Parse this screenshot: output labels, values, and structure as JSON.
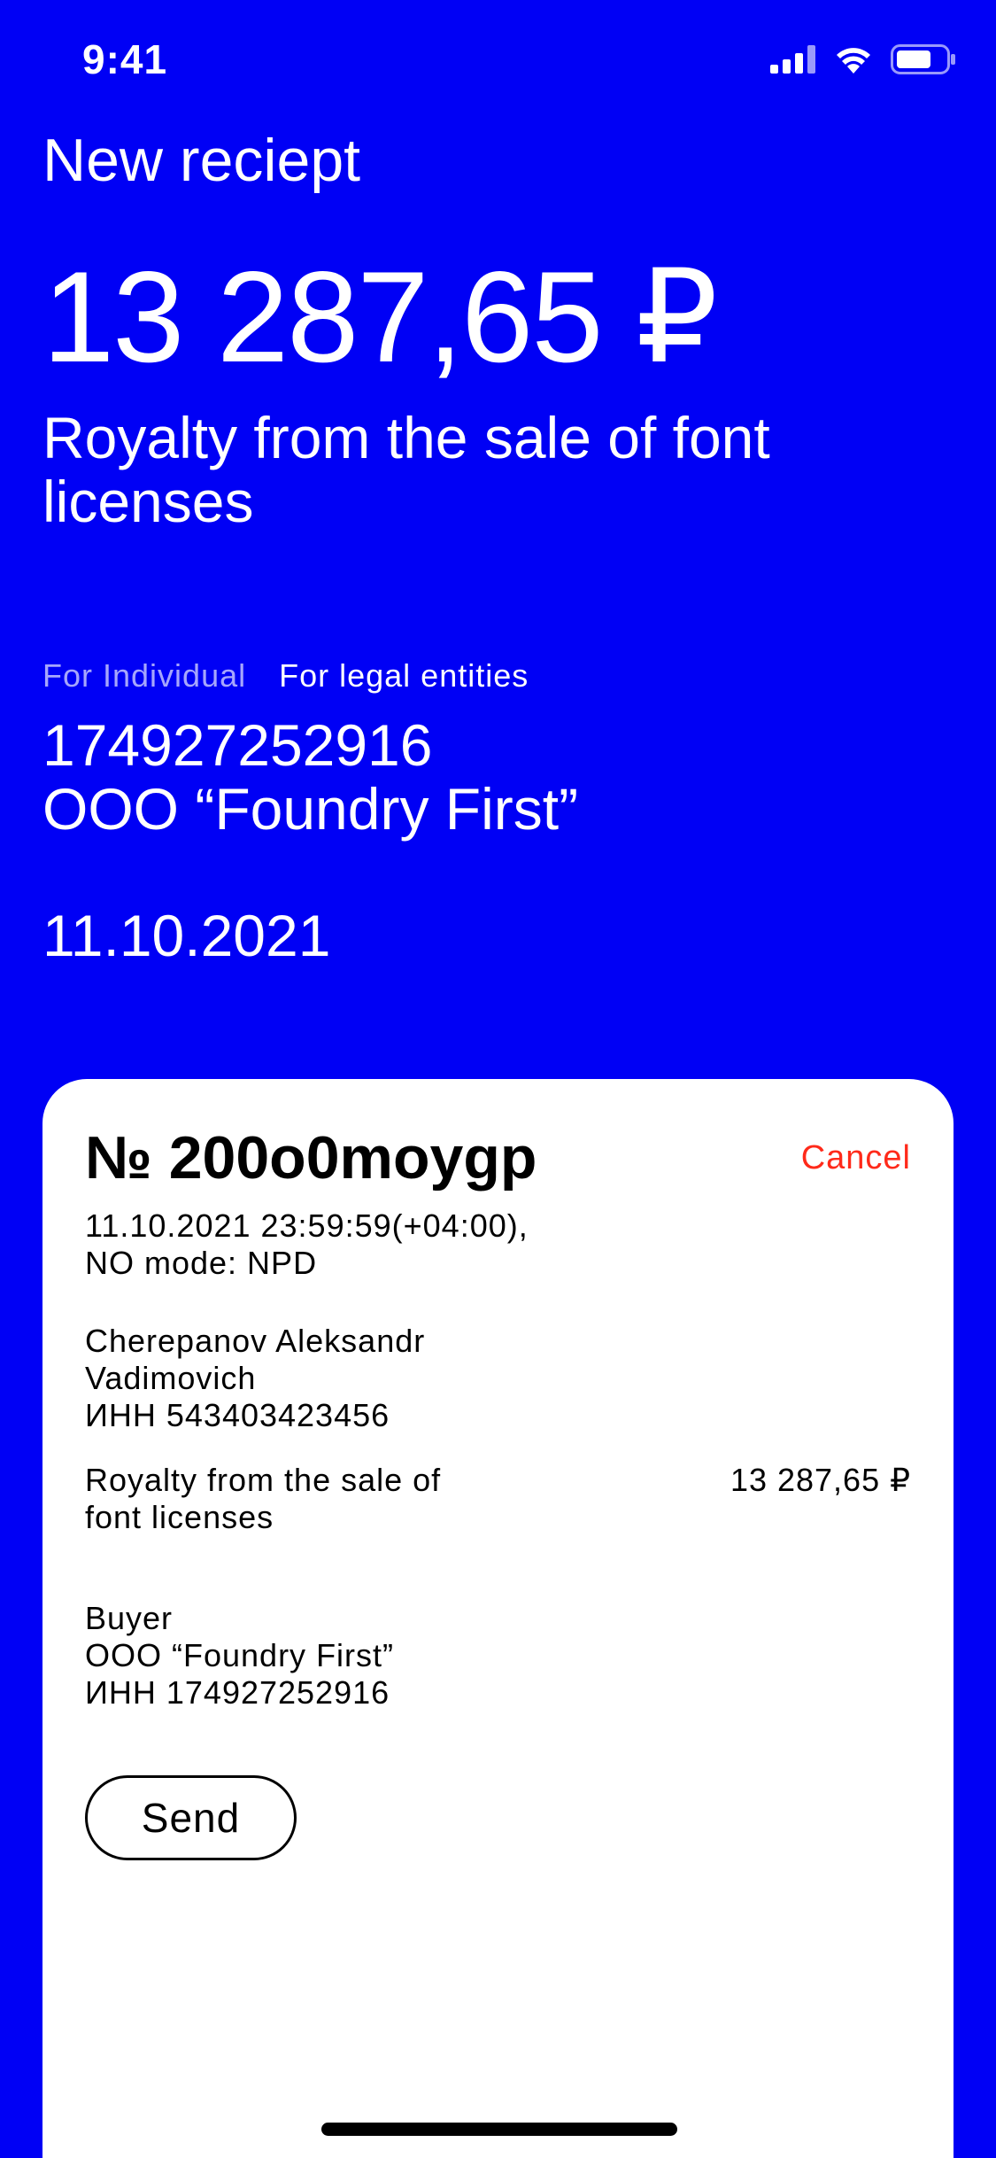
{
  "status_bar": {
    "time": "9:41"
  },
  "header": {
    "title": "New reciept"
  },
  "summary": {
    "amount": "13 287,65 ₽",
    "description_line1": "Royalty from the sale of font",
    "description_line2": "licenses"
  },
  "tabs": [
    {
      "label": "For Individual",
      "active": false
    },
    {
      "label": "For legal entities",
      "active": true
    }
  ],
  "buyer_summary": {
    "tax_id": "174927252916",
    "company": "ООО “Foundry First”",
    "date": "11.10.2021"
  },
  "receipt": {
    "number": "№ 200o0moygp",
    "cancel_label": "Cancel",
    "datetime": "11.10.2021 23:59:59(+04:00),",
    "mode": "NO mode: NPD",
    "seller_line1": "Cherepanov Aleksandr",
    "seller_line2": "Vadimovich",
    "seller_inn": "ИНН 543403423456",
    "item_line1": "Royalty from the sale of",
    "item_line2": "font licenses",
    "item_amount": "13 287,65 ₽",
    "buyer_label": "Buyer",
    "buyer_company": "ООО “Foundry First”",
    "buyer_inn": "ИНН 174927252916",
    "send_label": "Send"
  },
  "colors": {
    "background": "#0000F5",
    "card": "#FFFFFF",
    "cancel": "#FF2A1A"
  },
  "icons": [
    "signal-icon",
    "wifi-icon",
    "battery-icon"
  ]
}
